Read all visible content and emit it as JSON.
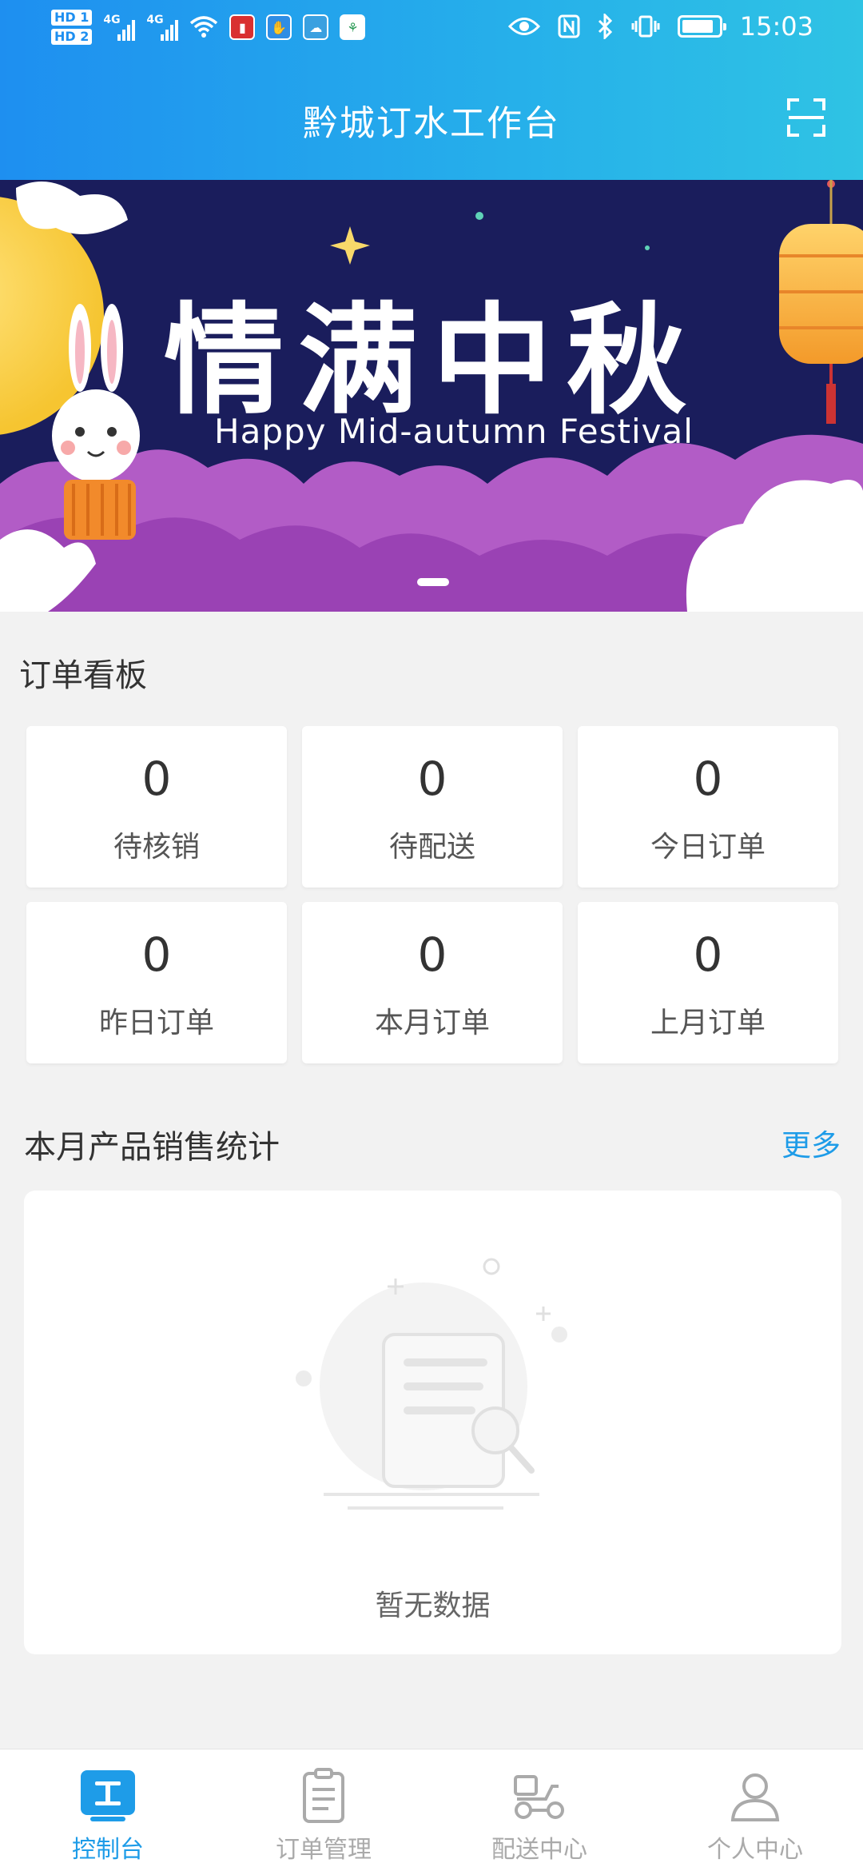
{
  "status_bar": {
    "time": "15:03",
    "sim1": "HD 1",
    "sim2": "HD 2",
    "network1": "4G",
    "network2": "4G",
    "icons": [
      "wifi-icon",
      "app-icon-red",
      "hand-icon",
      "cloud-icon",
      "app-icon-green",
      "eye-icon",
      "nfc-icon",
      "bluetooth-icon",
      "vibrate-icon",
      "battery-icon"
    ]
  },
  "header": {
    "title": "黔城订水工作台",
    "scan_icon": "scan-icon"
  },
  "banner": {
    "title": "情满中秋",
    "subtitle": "Happy Mid-autumn Festival"
  },
  "order_board": {
    "title": "订单看板",
    "cards": [
      {
        "value": "0",
        "label": "待核销"
      },
      {
        "value": "0",
        "label": "待配送"
      },
      {
        "value": "0",
        "label": "今日订单"
      },
      {
        "value": "0",
        "label": "昨日订单"
      },
      {
        "value": "0",
        "label": "本月订单"
      },
      {
        "value": "0",
        "label": "上月订单"
      }
    ]
  },
  "sales_stats": {
    "title": "本月产品销售统计",
    "more_label": "更多",
    "empty_text": "暂无数据"
  },
  "tabbar": {
    "tabs": [
      {
        "label": "控制台",
        "icon": "console-icon",
        "active": true
      },
      {
        "label": "订单管理",
        "icon": "clipboard-icon",
        "active": false
      },
      {
        "label": "配送中心",
        "icon": "scooter-icon",
        "active": false
      },
      {
        "label": "个人中心",
        "icon": "user-icon",
        "active": false
      }
    ]
  },
  "colors": {
    "accent": "#1e9ce8",
    "header_start": "#1e8ff0",
    "header_end": "#2fc3e4",
    "banner_bg": "#1a1d5c"
  }
}
